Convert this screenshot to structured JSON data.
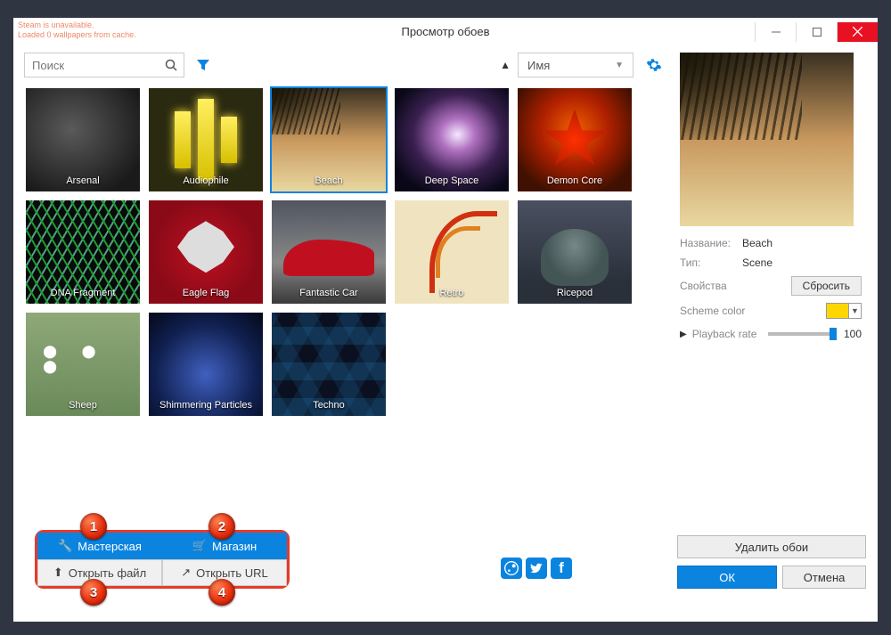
{
  "title": "Просмотр обоев",
  "warnings": [
    "Steam is unavailable.",
    "Loaded 0 wallpapers from cache."
  ],
  "search": {
    "placeholder": "Поиск"
  },
  "sort": {
    "field": "Имя"
  },
  "thumbnails": [
    {
      "label": "Arsenal"
    },
    {
      "label": "Audiophile"
    },
    {
      "label": "Beach",
      "selected": true
    },
    {
      "label": "Deep Space"
    },
    {
      "label": "Demon Core"
    },
    {
      "label": "DNA Fragment"
    },
    {
      "label": "Eagle Flag"
    },
    {
      "label": "Fantastic Car"
    },
    {
      "label": "Retro"
    },
    {
      "label": "Ricepod"
    },
    {
      "label": "Sheep"
    },
    {
      "label": "Shimmering Particles"
    },
    {
      "label": "Techno"
    }
  ],
  "sourceButtons": {
    "workshop": "Мастерская",
    "store": "Магазин",
    "openFile": "Открыть файл",
    "openUrl": "Открыть URL"
  },
  "annotations": {
    "b1": "1",
    "b2": "2",
    "b3": "3",
    "b4": "4"
  },
  "details": {
    "nameLabel": "Название:",
    "nameValue": "Beach",
    "typeLabel": "Тип:",
    "typeValue": "Scene",
    "propsLabel": "Свойства",
    "resetLabel": "Сбросить",
    "schemeLabel": "Scheme color",
    "schemeColor": "#f5d020",
    "playbackLabel": "Playback rate",
    "playbackValue": "100"
  },
  "actions": {
    "delete": "Удалить обои",
    "ok": "ОК",
    "cancel": "Отмена"
  }
}
